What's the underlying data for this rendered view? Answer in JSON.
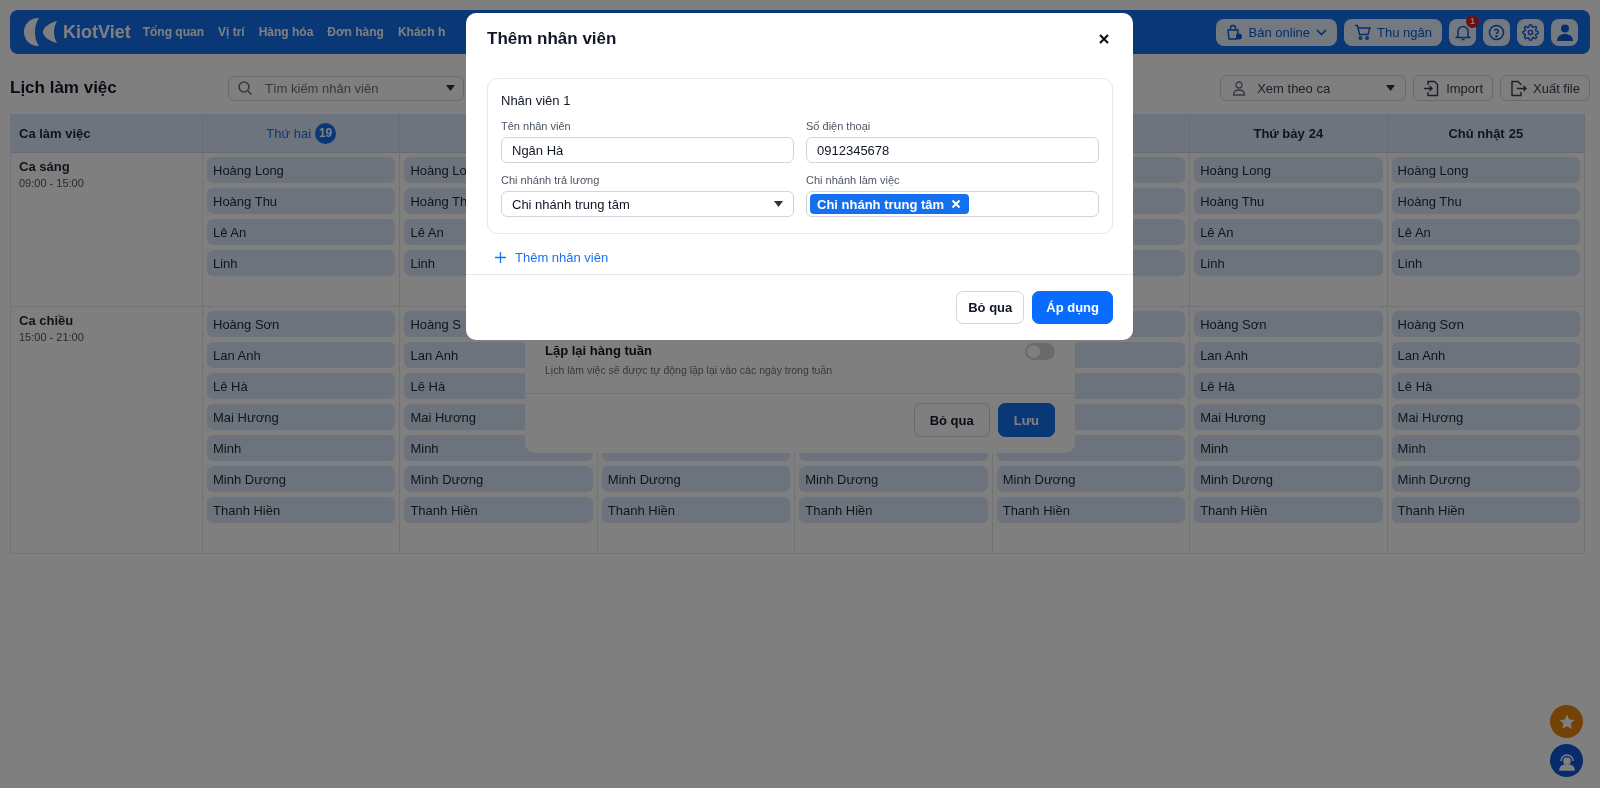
{
  "topbar": {
    "logo": "KiotViet",
    "nav": [
      {
        "label": "Tổng quan"
      },
      {
        "label": "Vị trí"
      },
      {
        "label": "Hàng hóa"
      },
      {
        "label": "Đơn hàng"
      },
      {
        "label": "Khách h"
      }
    ],
    "actions": [
      {
        "kind": "dropdown",
        "label": "Bán online"
      },
      {
        "kind": "cart",
        "label": "Thu ngân"
      }
    ],
    "notification_count": "1"
  },
  "toolbar": {
    "title": "Lịch làm việc",
    "search": {
      "placeholder": "Tìm kiếm nhân viên"
    },
    "view_select": {
      "value": "Xem theo ca"
    },
    "buttons": [
      {
        "kind": "import",
        "label": "Import"
      },
      {
        "kind": "export",
        "label": "Xuất file"
      }
    ]
  },
  "schedule": {
    "corner": "Ca làm việc",
    "days_start": [
      {
        "label": "Thứ hai",
        "date": "19",
        "selected": true
      }
    ],
    "days_end": [
      {
        "label": "Thứ bảy",
        "date": "24",
        "selected": false
      },
      {
        "label": "Chủ nhật",
        "date": "25",
        "selected": false
      }
    ],
    "shifts": [
      {
        "name": "Ca sáng",
        "time": "09:00 - 15:00",
        "rows": [
          [
            "Hoàng Long",
            "Hoàng Lo",
            null,
            null,
            null,
            "Hoàng Long",
            "Hoàng Long"
          ],
          [
            "Hoàng Thu",
            "Hoàng Th",
            null,
            null,
            null,
            "Hoàng Thu",
            "Hoàng Thu"
          ],
          [
            "Lê An",
            "Lê An",
            null,
            null,
            null,
            "Lê An",
            "Lê An"
          ],
          [
            "Linh",
            "Linh",
            null,
            null,
            null,
            "Linh",
            "Linh"
          ]
        ]
      },
      {
        "name": "Ca chiều",
        "time": "15:00 - 21:00",
        "rows": [
          [
            "Hoàng Sơn",
            "Hoàng S",
            null,
            null,
            null,
            "Hoàng Sơn",
            "Hoàng Sơn"
          ],
          [
            "Lan Anh",
            "Lan Anh",
            null,
            null,
            null,
            "Lan Anh",
            "Lan Anh"
          ],
          [
            "Lê Hà",
            "Lê Hà",
            null,
            null,
            null,
            "Lê Hà",
            "Lê Hà"
          ],
          [
            "Mai Hương",
            "Mai Hương",
            null,
            null,
            null,
            "Mai Hương",
            "Mai Hương"
          ],
          [
            "Minh",
            "Minh",
            null,
            null,
            null,
            "Minh",
            "Minh"
          ],
          [
            "Minh Dương",
            "Minh Dương",
            "Minh Dương",
            "Minh Dương",
            "Minh Dương",
            "Minh Dương",
            "Minh Dương"
          ],
          [
            "Thanh Hiền",
            "Thanh Hiền",
            "Thanh Hiền",
            "Thanh Hiền",
            "Thanh Hiền",
            "Thanh Hiền",
            "Thanh Hiền"
          ]
        ]
      }
    ]
  },
  "repeat_dialog": {
    "toggle": {
      "label": "Lặp lại hàng tuần",
      "description": "Lịch làm việc sẽ được tự động lặp lại vào các ngày trong tuần",
      "on": false
    },
    "buttons": [
      {
        "kind": "secondary",
        "label": "Bỏ qua"
      },
      {
        "kind": "primary",
        "label": "Lưu"
      }
    ]
  },
  "add_dialog": {
    "title": "Thêm nhân viên",
    "employees": [
      {
        "heading": "Nhân viên 1",
        "fields": [
          {
            "kind": "text",
            "label": "Tên nhân viên",
            "value": "Ngân Hà"
          },
          {
            "kind": "text",
            "label": "Số điện thoại",
            "value": "0912345678"
          },
          {
            "kind": "select",
            "label": "Chi nhánh trả lương",
            "value": "Chi nhánh trung tâm"
          },
          {
            "kind": "tags",
            "label": "Chi nhánh làm việc",
            "tags": [
              "Chi nhánh trung tâm"
            ]
          }
        ]
      }
    ],
    "add_link": "Thêm nhân viên",
    "buttons": [
      {
        "kind": "secondary",
        "label": "Bỏ qua"
      },
      {
        "kind": "primary",
        "label": "Áp dụng"
      }
    ]
  }
}
